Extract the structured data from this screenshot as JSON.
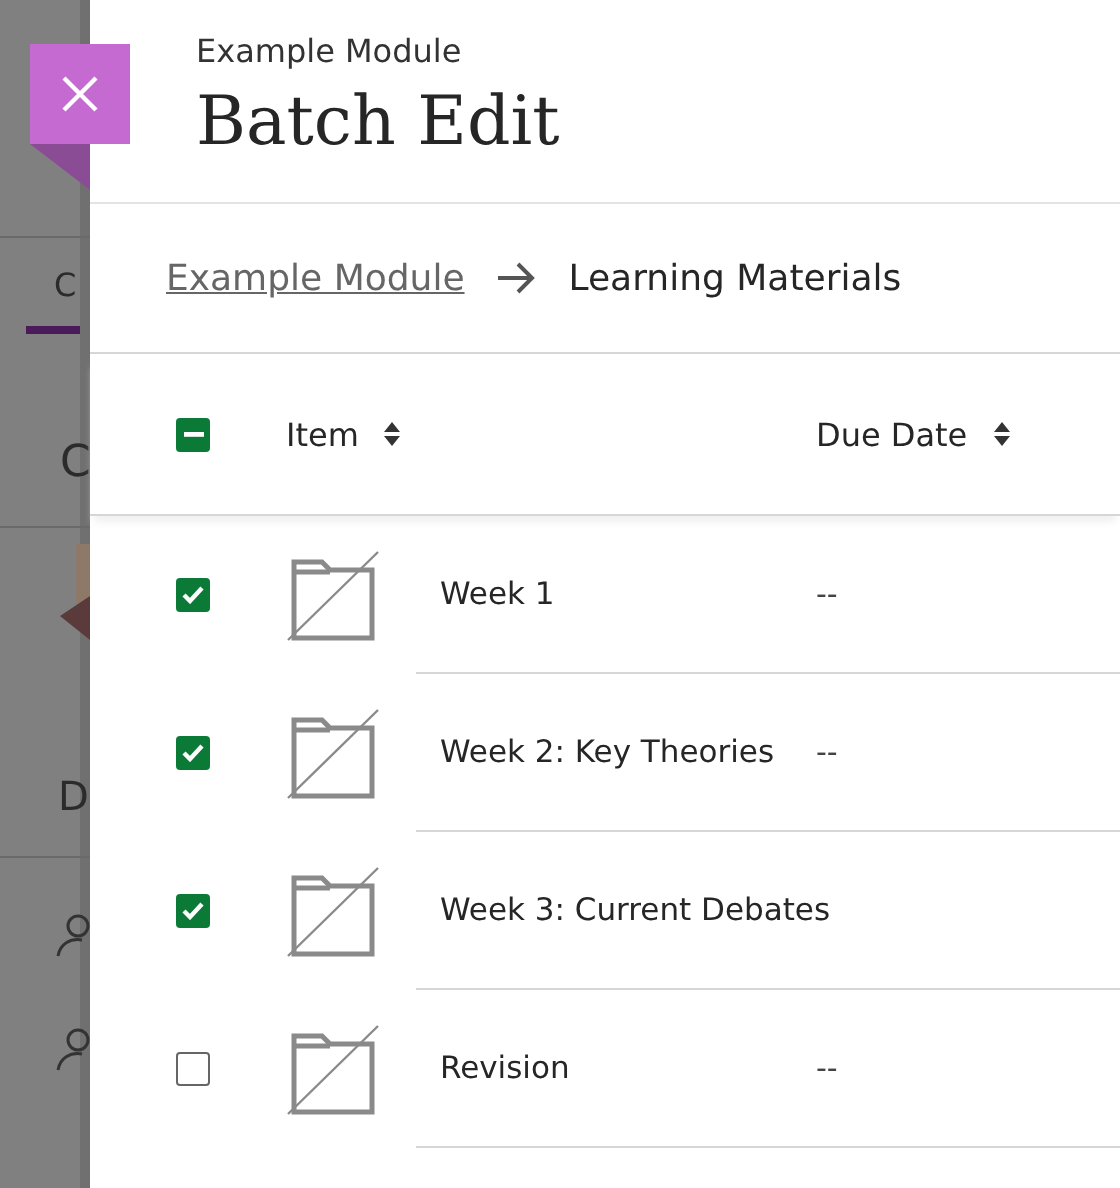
{
  "background": {
    "texts": [
      "C",
      "C",
      "D"
    ]
  },
  "panel": {
    "subtitle": "Example Module",
    "title": "Batch Edit"
  },
  "breadcrumb": [
    {
      "label": "Example Module"
    },
    {
      "label": "Learning Materials"
    }
  ],
  "table": {
    "select_all": {
      "checked": true,
      "indeterminate": true
    },
    "columns": [
      "Item",
      "Due Date"
    ],
    "rows": [
      {
        "checked": true,
        "name": "Week 1",
        "due": "--"
      },
      {
        "checked": true,
        "name": "Week 2: Key Theories",
        "due": "--"
      },
      {
        "checked": true,
        "name": "Week 3: Current Debates"
      },
      {
        "checked": false,
        "name": "Revision",
        "due": "--"
      }
    ]
  }
}
